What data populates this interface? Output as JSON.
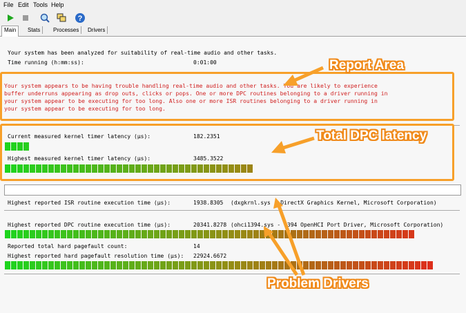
{
  "menu": [
    "File",
    "Edit",
    "Tools",
    "Help"
  ],
  "tabs": [
    "Main",
    "Stats",
    "Processes",
    "Drivers"
  ],
  "analysis": {
    "line1": "Your system has been analyzed for suitability of real-time audio and other tasks.",
    "time_label": "Time running (h:mm:ss):",
    "time_value": "0:01:00"
  },
  "report": [
    "Your system appears to be having trouble handling real-time audio and other tasks. You are likely to experience",
    "buffer underruns appearing as drop outs, clicks or pops. One or more DPC routines belonging to a driver running in",
    "your system appear to be executing for too long. Also one or more ISR routines belonging to a driver running in",
    "your system appear to be executing for too long."
  ],
  "metrics": {
    "current_kernel": {
      "label": "Current measured kernel timer latency (µs):",
      "value": "182.2351",
      "fraction": 0.05
    },
    "highest_kernel": {
      "label": "Highest measured kernel timer latency (µs):",
      "value": "3485.3522",
      "fraction": 0.55
    },
    "highest_isr": {
      "label": "Highest reported ISR routine execution time (µs):",
      "value": "1938.8305",
      "driver": "(dxgkrnl.sys - DirectX Graphics Kernel, Microsoft Corporation)",
      "fraction": 0
    },
    "highest_dpc": {
      "label": "Highest reported DPC routine execution time (µs):",
      "value": "20341.8278",
      "driver": "(ohci1394.sys - 1394 OpenHCI Port Driver, Microsoft Corporation)",
      "fraction": 0.91
    },
    "pagefault_count": {
      "label": "Reported total hard pagefault count:",
      "value": "14"
    },
    "pagefault_res": {
      "label": "Highest reported hard pagefault resolution time (µs):",
      "value": "22924.6672",
      "fraction": 0.95
    }
  },
  "callouts": {
    "report_area": "Report Area",
    "total_dpc": "Total DPC latency",
    "problem_drivers": "Problem Drivers"
  },
  "colors": {
    "accent": "#f7a02a",
    "report_text": "#d02020",
    "bar_green": "#1ed41e",
    "bar_red": "#e8201c"
  }
}
